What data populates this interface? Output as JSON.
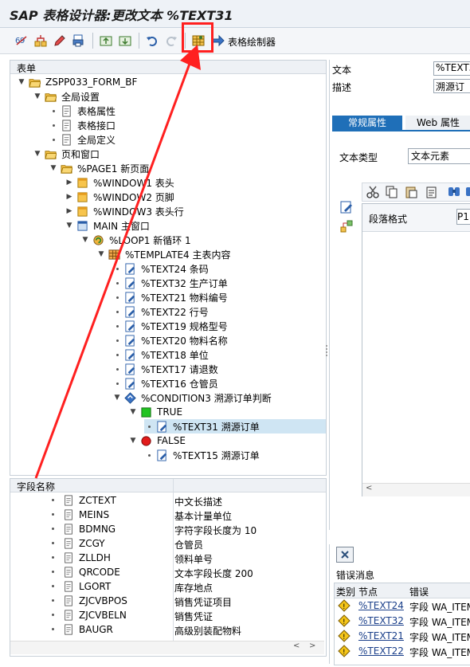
{
  "title": "SAP 表格设计器:更改文本 %TEXT31",
  "toolbar": {
    "form_painter_label": "表格绘制器",
    "icons": [
      "technical-names-icon",
      "hierarchy-icon",
      "edit-pen-icon",
      "print-preview-icon",
      "upload-icon",
      "download-icon",
      "undo-icon",
      "redo-icon",
      "table-painter-icon",
      "arrow-right-icon"
    ]
  },
  "tree": {
    "header": "表单",
    "nodes": [
      {
        "label": "ZSPP033_FORM_BF",
        "icon": "folder-open-icon"
      },
      {
        "label": "全局设置",
        "icon": "folder-open-icon"
      },
      {
        "label": "表格属性",
        "icon": "document-icon"
      },
      {
        "label": "表格接口",
        "icon": "document-icon"
      },
      {
        "label": "全局定义",
        "icon": "document-icon"
      },
      {
        "label": "页和窗口",
        "icon": "folder-open-icon"
      },
      {
        "label": "%PAGE1 新页面",
        "icon": "folder-open-icon"
      },
      {
        "label": "%WINDOW1 表头",
        "icon": "window-icon"
      },
      {
        "label": "%WINDOW2 页脚",
        "icon": "window-icon"
      },
      {
        "label": "%WINDOW3 表头行",
        "icon": "window-icon"
      },
      {
        "label": "MAIN 主窗口",
        "icon": "main-window-icon"
      },
      {
        "label": "%LOOP1 新循环 1",
        "icon": "loop-icon"
      },
      {
        "label": "%TEMPLATE4 主表内容",
        "icon": "template-grid-icon"
      },
      {
        "label": "%TEXT24 条码",
        "icon": "text-node-icon"
      },
      {
        "label": "%TEXT32 生产订单",
        "icon": "text-node-icon"
      },
      {
        "label": "%TEXT21 物料编号",
        "icon": "text-node-icon"
      },
      {
        "label": "%TEXT22 行号",
        "icon": "text-node-icon"
      },
      {
        "label": "%TEXT19 规格型号",
        "icon": "text-node-icon"
      },
      {
        "label": "%TEXT20 物料名称",
        "icon": "text-node-icon"
      },
      {
        "label": "%TEXT18 单位",
        "icon": "text-node-icon"
      },
      {
        "label": "%TEXT17 请退数",
        "icon": "text-node-icon"
      },
      {
        "label": "%TEXT16 仓管员",
        "icon": "text-node-icon"
      },
      {
        "label": "%CONDITION3 溯源订单判断",
        "icon": "condition-icon"
      },
      {
        "label": "TRUE",
        "icon": "true-green-icon"
      },
      {
        "label": "%TEXT31 溯源订单",
        "icon": "text-node-icon"
      },
      {
        "label": "FALSE",
        "icon": "false-red-icon"
      },
      {
        "label": "%TEXT15 溯源订单",
        "icon": "text-node-icon"
      }
    ]
  },
  "fields": {
    "header": "字段名称",
    "rows": [
      {
        "name": "ZCTEXT",
        "desc": "中文长描述"
      },
      {
        "name": "MEINS",
        "desc": "基本计量单位"
      },
      {
        "name": "BDMNG",
        "desc": "字符字段长度为 10"
      },
      {
        "name": "ZCGY",
        "desc": "仓管员"
      },
      {
        "name": "ZLLDH",
        "desc": "领料单号"
      },
      {
        "name": "QRCODE",
        "desc": "文本字段长度 200"
      },
      {
        "name": "LGORT",
        "desc": "库存地点"
      },
      {
        "name": "ZJCVBPOS",
        "desc": "销售凭证项目"
      },
      {
        "name": "ZJCVBELN",
        "desc": "销售凭证"
      },
      {
        "name": "BAUGR",
        "desc": "高级别装配物料"
      }
    ]
  },
  "right": {
    "text_label": "文本",
    "text_value": "%TEXT3",
    "desc_label": "描述",
    "desc_value": "溯源订",
    "tab_general": "常规属性",
    "tab_web": "Web 属性",
    "text_type_label": "文本类型",
    "text_type_value": "文本元素",
    "para_format_label": "段落格式",
    "para_format_value": "P1"
  },
  "errors": {
    "title": "错误消息",
    "col_type": "类别",
    "col_node": "节点",
    "col_error": "错误",
    "rows": [
      {
        "node": "%TEXT24",
        "error": "字段 WA_ITEM"
      },
      {
        "node": "%TEXT32",
        "error": "字段 WA_ITEM"
      },
      {
        "node": "%TEXT21",
        "error": "字段 WA_ITEM"
      },
      {
        "node": "%TEXT22",
        "error": "字段 WA_ITEM"
      }
    ]
  }
}
